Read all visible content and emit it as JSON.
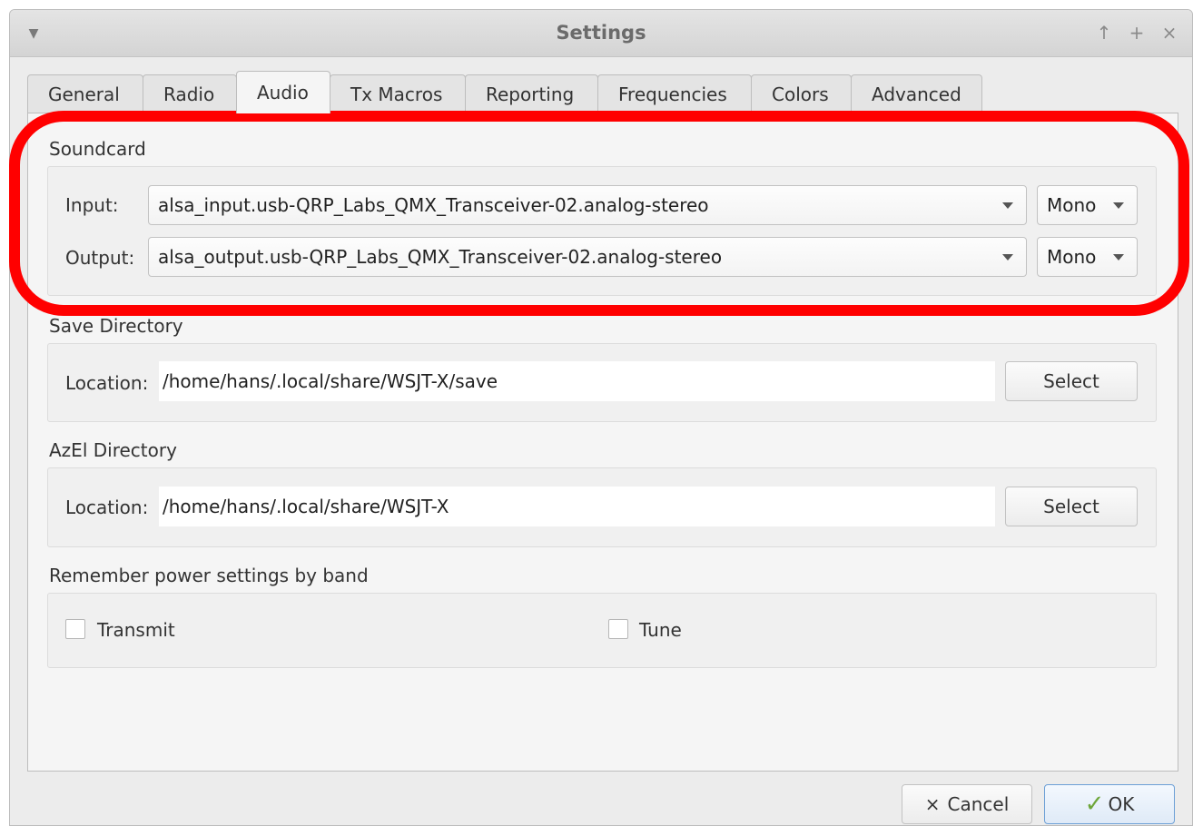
{
  "window": {
    "title": "Settings",
    "buttons": {
      "up": "↑",
      "maximize": "+",
      "close": "×"
    },
    "menu_glyph": "▼"
  },
  "tabs": [
    {
      "label": "General",
      "active": false
    },
    {
      "label": "Radio",
      "active": false
    },
    {
      "label": "Audio",
      "active": true
    },
    {
      "label": "Tx Macros",
      "active": false
    },
    {
      "label": "Reporting",
      "active": false
    },
    {
      "label": "Frequencies",
      "active": false
    },
    {
      "label": "Colors",
      "active": false
    },
    {
      "label": "Advanced",
      "active": false
    }
  ],
  "soundcard": {
    "title": "Soundcard",
    "input_label": "Input:",
    "input_value": "alsa_input.usb-QRP_Labs_QMX_Transceiver-02.analog-stereo",
    "input_channel": "Mono",
    "output_label": "Output:",
    "output_value": "alsa_output.usb-QRP_Labs_QMX_Transceiver-02.analog-stereo",
    "output_channel": "Mono"
  },
  "save_directory": {
    "title": "Save Directory",
    "location_label": "Location:",
    "location_value": "/home/hans/.local/share/WSJT-X/save",
    "select_label": "Select"
  },
  "azel_directory": {
    "title": "AzEl Directory",
    "location_label": "Location:",
    "location_value": "/home/hans/.local/share/WSJT-X",
    "select_label": "Select"
  },
  "power_settings": {
    "title": "Remember power settings by band",
    "transmit_label": "Transmit",
    "transmit_checked": false,
    "tune_label": "Tune",
    "tune_checked": false
  },
  "footer": {
    "cancel_glyph": "×",
    "cancel_label": "Cancel",
    "ok_glyph": "✓",
    "ok_label": "OK"
  },
  "colors": {
    "highlight": "#ff0000",
    "ok_border": "#6c9fd6"
  }
}
